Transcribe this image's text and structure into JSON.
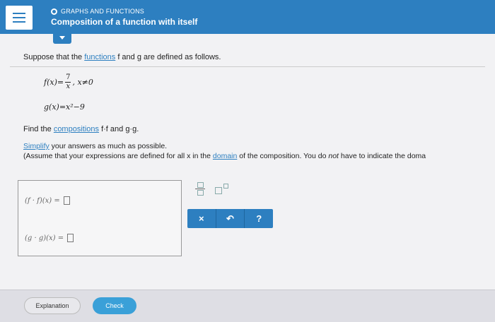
{
  "header": {
    "section": "GRAPHS AND FUNCTIONS",
    "title": "Composition of a function with itself"
  },
  "problem": {
    "intro_before": "Suppose that the ",
    "intro_link": "functions",
    "intro_after": " f and g are defined as follows.",
    "f_lhs": "f(x)=",
    "f_num": "7",
    "f_den": "x",
    "f_cond": ", x≠0",
    "g_def": "g(x)=x²−9",
    "find_before": "Find the ",
    "find_link": "compositions",
    "find_after": " f·f and g·g.",
    "simplify_link": "Simplify",
    "simplify_after": " your answers as much as possible.",
    "assume_before": "(Assume that your expressions are defined for all x in the ",
    "assume_link": "domain",
    "assume_after_a": " of the composition. You do ",
    "assume_not": "not",
    "assume_after_b": " have to indicate the doma"
  },
  "answers": {
    "row1_label": "(f · f)(x) =",
    "row2_label": "(g · g)(x) ="
  },
  "toolbar": {
    "clear": "×",
    "undo": "↶",
    "help": "?"
  },
  "footer": {
    "explanation": "Explanation",
    "check": "Check"
  }
}
